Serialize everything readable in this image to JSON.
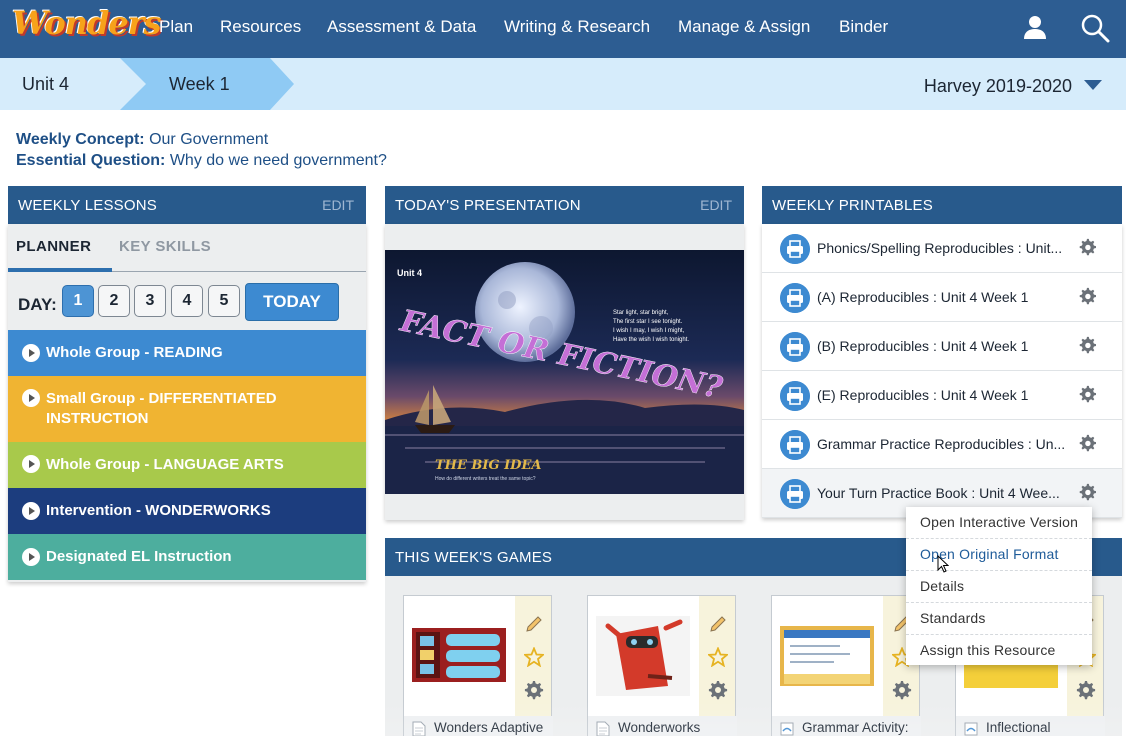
{
  "brand": {
    "logo_text": "Wonders"
  },
  "nav": {
    "items": [
      "Plan",
      "Resources",
      "Assessment & Data",
      "Writing & Research",
      "Manage & Assign",
      "Binder"
    ],
    "user_icon": "user-icon",
    "search_icon": "search-icon"
  },
  "breadcrumb": {
    "unit": "Unit 4",
    "week": "Week 1"
  },
  "class_select": {
    "value": "Harvey 2019-2020"
  },
  "concept": {
    "label": "Weekly Concept:",
    "value": "Our Government",
    "question_label": "Essential Question:",
    "question_value": "Why do we need government?"
  },
  "weekly_lessons": {
    "title": "WEEKLY LESSONS",
    "edit": "EDIT",
    "tabs": [
      "PLANNER",
      "KEY SKILLS"
    ],
    "day_label": "DAY:",
    "days": [
      "1",
      "2",
      "3",
      "4",
      "5"
    ],
    "active_day": "1",
    "today": "TODAY",
    "lessons": [
      {
        "label": "Whole Group - READING",
        "color": "#3d8ad1"
      },
      {
        "label": "Small Group - DIFFERENTIATED INSTRUCTION",
        "color": "#f0b432"
      },
      {
        "label": "Whole Group - LANGUAGE ARTS",
        "color": "#a8c94b"
      },
      {
        "label": "Intervention - WONDERWORKS",
        "color": "#1c3d7e"
      },
      {
        "label": "Designated EL Instruction",
        "color": "#4dae9e"
      }
    ]
  },
  "presentation": {
    "title": "TODAY'S PRESENTATION",
    "edit": "EDIT",
    "slide": {
      "unit": "Unit 4",
      "heading": "FACT OR FICTION?",
      "poem": [
        "Star light, star bright,",
        "The first star I see tonight.",
        "I wish I may, I wish I might,",
        "Have the wish I wish tonight."
      ],
      "footer": "THE BIG IDEA",
      "subfooter": "How do different writers treat the same topic?"
    }
  },
  "printables": {
    "title": "WEEKLY PRINTABLES",
    "items": [
      "Phonics/Spelling Reproducibles : Unit...",
      "(A) Reproducibles : Unit 4 Week 1",
      "(B) Reproducibles : Unit 4 Week 1",
      "(E) Reproducibles : Unit 4 Week 1",
      "Grammar Practice Reproducibles : Un...",
      "Your Turn Practice Book : Unit 4 Wee..."
    ]
  },
  "context_menu": {
    "items": [
      "Open Interactive Version",
      "Open Original Format",
      "Details",
      "Standards",
      "Assign this Resource"
    ],
    "hovered": "Open Original Format"
  },
  "games": {
    "title": "THIS WEEK'S GAMES",
    "items": [
      "Wonders Adaptive",
      "Wonderworks",
      "Grammar Activity:",
      "Inflectional"
    ]
  }
}
